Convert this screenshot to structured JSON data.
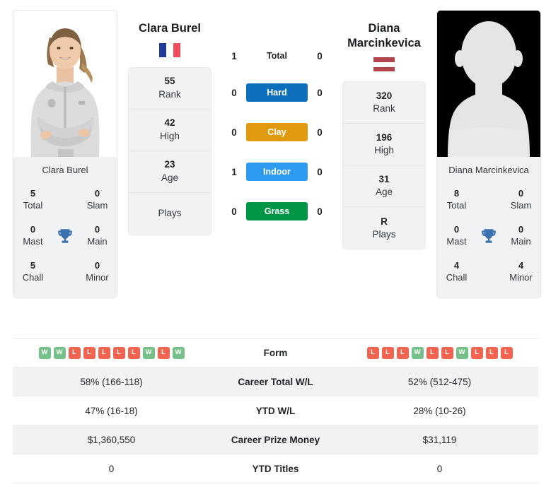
{
  "players": {
    "left": {
      "name": "Clara Burel",
      "card_name": "Clara Burel",
      "country": "France",
      "flag": "fr-flag-icon",
      "photo_type": "photo-portrait",
      "titles": [
        {
          "num": "5",
          "label": "Total"
        },
        {
          "num": "0",
          "label": "Slam"
        },
        {
          "num": "0",
          "label": "Mast"
        },
        {
          "num": "0",
          "label": "Main"
        },
        {
          "num": "5",
          "label": "Chall"
        },
        {
          "num": "0",
          "label": "Minor"
        }
      ],
      "stats": [
        {
          "num": "55",
          "label": "Rank"
        },
        {
          "num": "42",
          "label": "High"
        },
        {
          "num": "23",
          "label": "Age"
        },
        {
          "num": "",
          "label": "Plays"
        }
      ],
      "form": [
        "W",
        "W",
        "L",
        "L",
        "L",
        "L",
        "L",
        "W",
        "L",
        "W"
      ],
      "career_total_wl": "58% (166-118)",
      "ytd_wl": "47% (16-18)",
      "career_prize_money": "$1,360,550",
      "ytd_titles": "0"
    },
    "right": {
      "name": "Diana Marcinkevica",
      "card_name": "Diana Marcinkevica",
      "country": "Latvia",
      "flag": "lv-flag-icon",
      "photo_type": "placeholder-silhouette",
      "titles": [
        {
          "num": "8",
          "label": "Total"
        },
        {
          "num": "0",
          "label": "Slam"
        },
        {
          "num": "0",
          "label": "Mast"
        },
        {
          "num": "0",
          "label": "Main"
        },
        {
          "num": "4",
          "label": "Chall"
        },
        {
          "num": "4",
          "label": "Minor"
        }
      ],
      "stats": [
        {
          "num": "320",
          "label": "Rank"
        },
        {
          "num": "196",
          "label": "High"
        },
        {
          "num": "31",
          "label": "Age"
        },
        {
          "num": "R",
          "label": "Plays"
        }
      ],
      "form": [
        "L",
        "L",
        "L",
        "W",
        "L",
        "L",
        "W",
        "L",
        "L",
        "L"
      ],
      "career_total_wl": "52% (512-475)",
      "ytd_wl": "28% (10-26)",
      "career_prize_money": "$31,119",
      "ytd_titles": "0"
    }
  },
  "h2h": [
    {
      "label": "Total",
      "left": "1",
      "right": "0",
      "surface": false,
      "color": ""
    },
    {
      "label": "Hard",
      "left": "0",
      "right": "0",
      "surface": true,
      "color": "#0f6fbf"
    },
    {
      "label": "Clay",
      "left": "0",
      "right": "0",
      "surface": true,
      "color": "#e09a0f"
    },
    {
      "label": "Indoor",
      "left": "1",
      "right": "0",
      "surface": true,
      "color": "#2e9bf0"
    },
    {
      "label": "Grass",
      "left": "0",
      "right": "0",
      "surface": true,
      "color": "#009645"
    }
  ],
  "table": {
    "rows": [
      {
        "label": "Form",
        "type": "form"
      },
      {
        "label": "Career Total W/L",
        "type": "text",
        "key": "career_total_wl"
      },
      {
        "label": "YTD W/L",
        "type": "text",
        "key": "ytd_wl"
      },
      {
        "label": "Career Prize Money",
        "type": "text",
        "key": "career_prize_money"
      },
      {
        "label": "YTD Titles",
        "type": "text",
        "key": "ytd_titles"
      }
    ]
  },
  "colors": {
    "win_badge": "#76c18a",
    "loss_badge": "#f26350",
    "trophy": "#3b72b0",
    "card_bg": "#f1f2f3"
  }
}
